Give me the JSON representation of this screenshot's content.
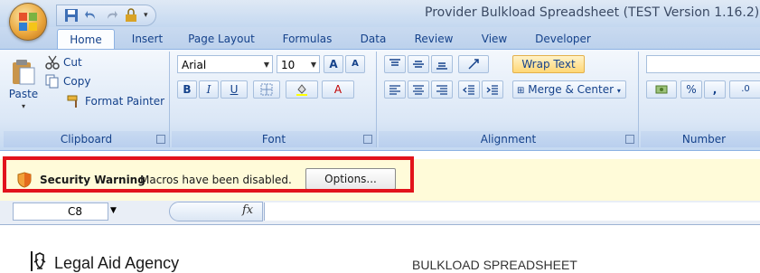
{
  "window": {
    "title": "Provider Bulkload Spreadsheet (TEST Version 1.16.2).xls"
  },
  "ribbon_tabs": [
    {
      "label": "Home",
      "active": true
    },
    {
      "label": "Insert"
    },
    {
      "label": "Page Layout"
    },
    {
      "label": "Formulas"
    },
    {
      "label": "Data"
    },
    {
      "label": "Review"
    },
    {
      "label": "View"
    },
    {
      "label": "Developer"
    }
  ],
  "clipboard": {
    "paste_label": "Paste",
    "cut_label": "Cut",
    "copy_label": "Copy",
    "format_painter_label": "Format Painter",
    "group_label": "Clipboard"
  },
  "font": {
    "font_name": "Arial",
    "font_size": "10",
    "grow_label": "A",
    "shrink_label": "A",
    "bold_label": "B",
    "italic_label": "I",
    "underline_label": "U",
    "font_color_label": "A",
    "group_label": "Font"
  },
  "alignment": {
    "wrap_text_label": "Wrap Text",
    "merge_center_label": "Merge & Center",
    "group_label": "Alignment"
  },
  "number": {
    "percent_label": "%",
    "comma_label": ",",
    "decimal_label": ".0",
    "group_label": "Number"
  },
  "security_bar": {
    "title": "Security Warning",
    "message": "Macros have been disabled.",
    "options_label": "Options..."
  },
  "formula_bar": {
    "name_box": "C8",
    "fx_label": "fx"
  },
  "sheet": {
    "agency_name": "Legal Aid Agency",
    "heading": "BULKLOAD SPREADSHEET"
  },
  "colors": {
    "ribbon_text": "#15428b",
    "highlight_border": "#e2131b",
    "security_bar_bg": "#fffbd9"
  }
}
